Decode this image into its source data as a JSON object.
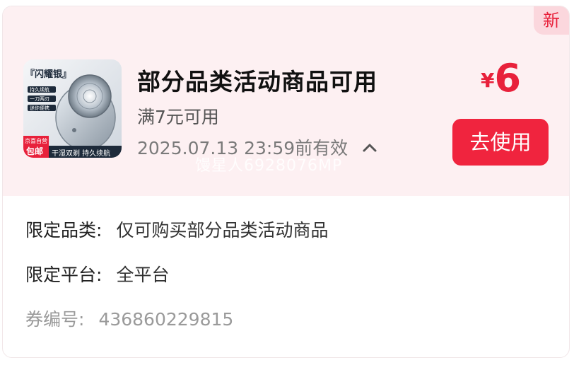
{
  "badge": {
    "new_label": "新"
  },
  "coupon": {
    "title": "部分品类活动商品可用",
    "condition": "满7元可用",
    "expiry": "2025.07.13 23:59前有效",
    "watermark": "馒星人6928076MP",
    "price": {
      "currency": "¥",
      "amount": "6"
    },
    "use_button": "去使用"
  },
  "product_image": {
    "brand": "『闪耀银』",
    "features": [
      "持久续航",
      "一刀两刃",
      "迷你便携"
    ],
    "promo_top": "京喜自营",
    "promo_bottom": "包邮",
    "tagline": "干湿双剃 持久续航"
  },
  "details": {
    "category_label": "限定品类:",
    "category_value": "仅可购买部分品类活动商品",
    "platform_label": "限定平台:",
    "platform_value": "全平台",
    "code_label": "券编号:",
    "code_value": "436860229815"
  },
  "colors": {
    "accent": "#f0243e",
    "top_bg": "#fdf0f2",
    "badge_bg": "#fbd7dd"
  },
  "icons": {
    "expand": "chevron-up-icon"
  }
}
